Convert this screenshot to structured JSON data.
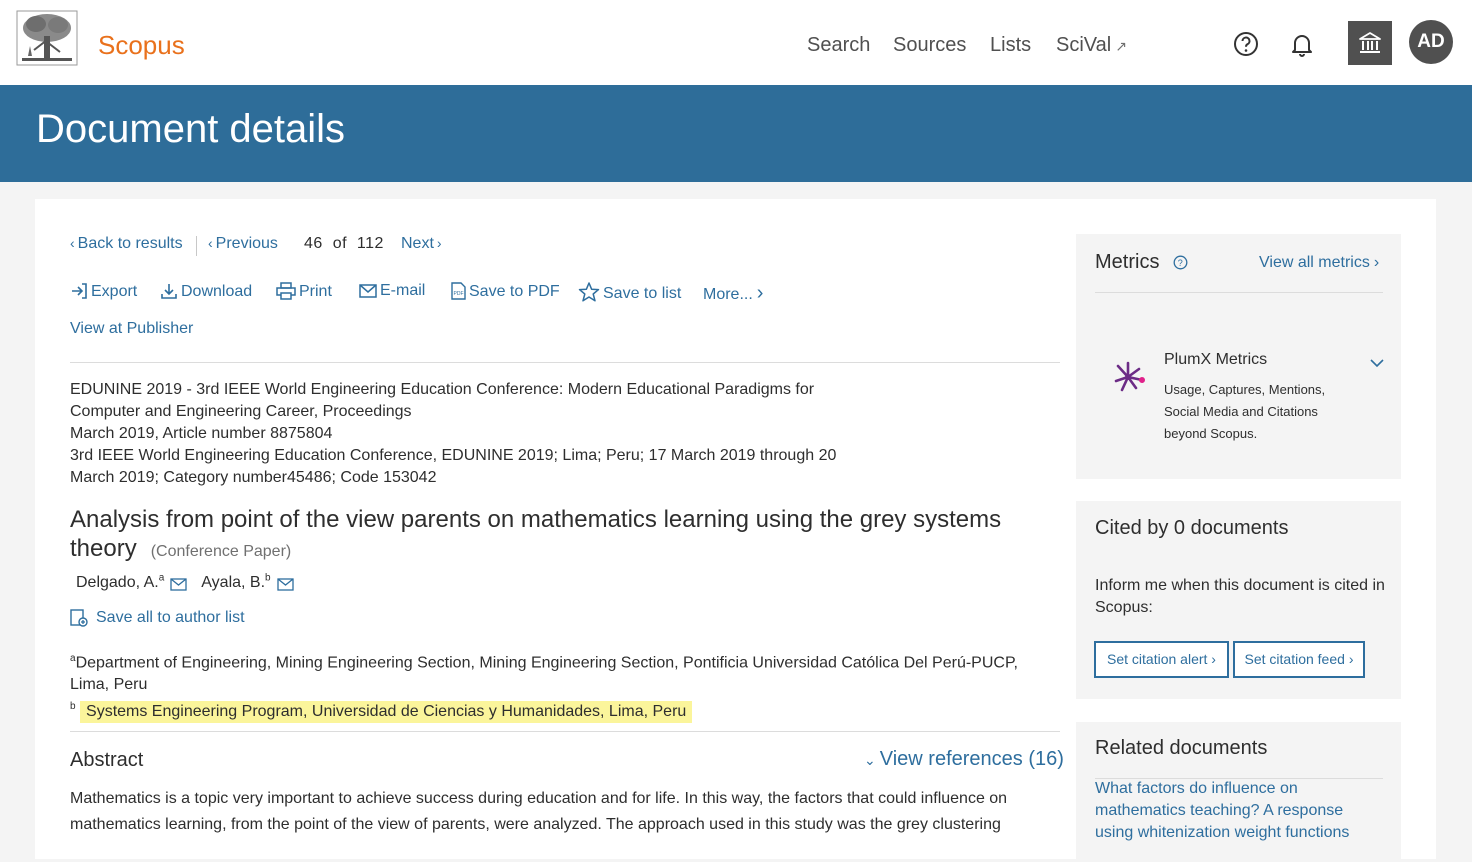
{
  "header": {
    "brand": "Scopus",
    "nav": {
      "search": "Search",
      "sources": "Sources",
      "lists": "Lists",
      "scival": "SciVal"
    },
    "avatar_initials": "AD"
  },
  "banner": {
    "title": "Document details"
  },
  "pager": {
    "back": "Back to results",
    "previous": "Previous",
    "current": "46",
    "of_label": "of",
    "total": "112",
    "next": "Next"
  },
  "actions": {
    "export": "Export",
    "download": "Download",
    "print": "Print",
    "email": "E-mail",
    "save_pdf": "Save to PDF",
    "save_list": "Save to list",
    "more": "More...",
    "publisher": "View at Publisher"
  },
  "source": {
    "line1": "EDUNINE 2019 - 3rd IEEE World Engineering Education Conference: Modern Educational Paradigms for",
    "line2": "Computer and Engineering Career, Proceedings",
    "line3": "March 2019, Article number 8875804",
    "line4": "3rd IEEE World Engineering Education Conference, EDUNINE 2019; Lima; Peru; 17 March 2019 through 20",
    "line5": "March 2019; Category number45486; Code 153042"
  },
  "document": {
    "title": "Analysis from point of the view parents on mathematics learning using the grey systems theory",
    "type": "(Conference Paper)"
  },
  "authors": [
    {
      "name": "Delgado, A.",
      "sup": "a"
    },
    {
      "name": "Ayala, B.",
      "sup": "b"
    }
  ],
  "save_author_list": "Save all to author list",
  "affiliations": {
    "a": {
      "sup": "a",
      "text": "Department of Engineering, Mining Engineering Section, Mining Engineering Section, Pontificia Universidad Católica Del Perú-PUCP, Lima, Peru"
    },
    "b": {
      "sup": "b",
      "text": "Systems Engineering Program, Universidad de Ciencias y Humanidades, Lima, Peru"
    }
  },
  "abstract": {
    "heading": "Abstract",
    "view_references": "View references (16)",
    "text": "Mathematics is a topic very important to achieve success during education and for life. In this way, the factors that could influence on mathematics learning, from the point of the view of parents, were analyzed. The approach used in this study was the grey clustering"
  },
  "metrics": {
    "title": "Metrics",
    "view_all": "View all metrics",
    "plumx_title": "PlumX Metrics",
    "plumx_desc": "Usage, Captures, Mentions, Social Media and Citations beyond Scopus."
  },
  "cited_by": {
    "title": "Cited by 0 documents",
    "desc": "Inform me when this document is cited in Scopus:",
    "alert_button": "Set citation alert",
    "feed_button": "Set citation feed"
  },
  "related": {
    "title": "Related documents",
    "first_doc": "What factors do influence on mathematics teaching? A response using whitenization weight functions"
  },
  "colors": {
    "brand": "#e9711c",
    "banner": "#2e6d99",
    "link": "#2e6e9e",
    "highlight": "#fbf59b"
  }
}
